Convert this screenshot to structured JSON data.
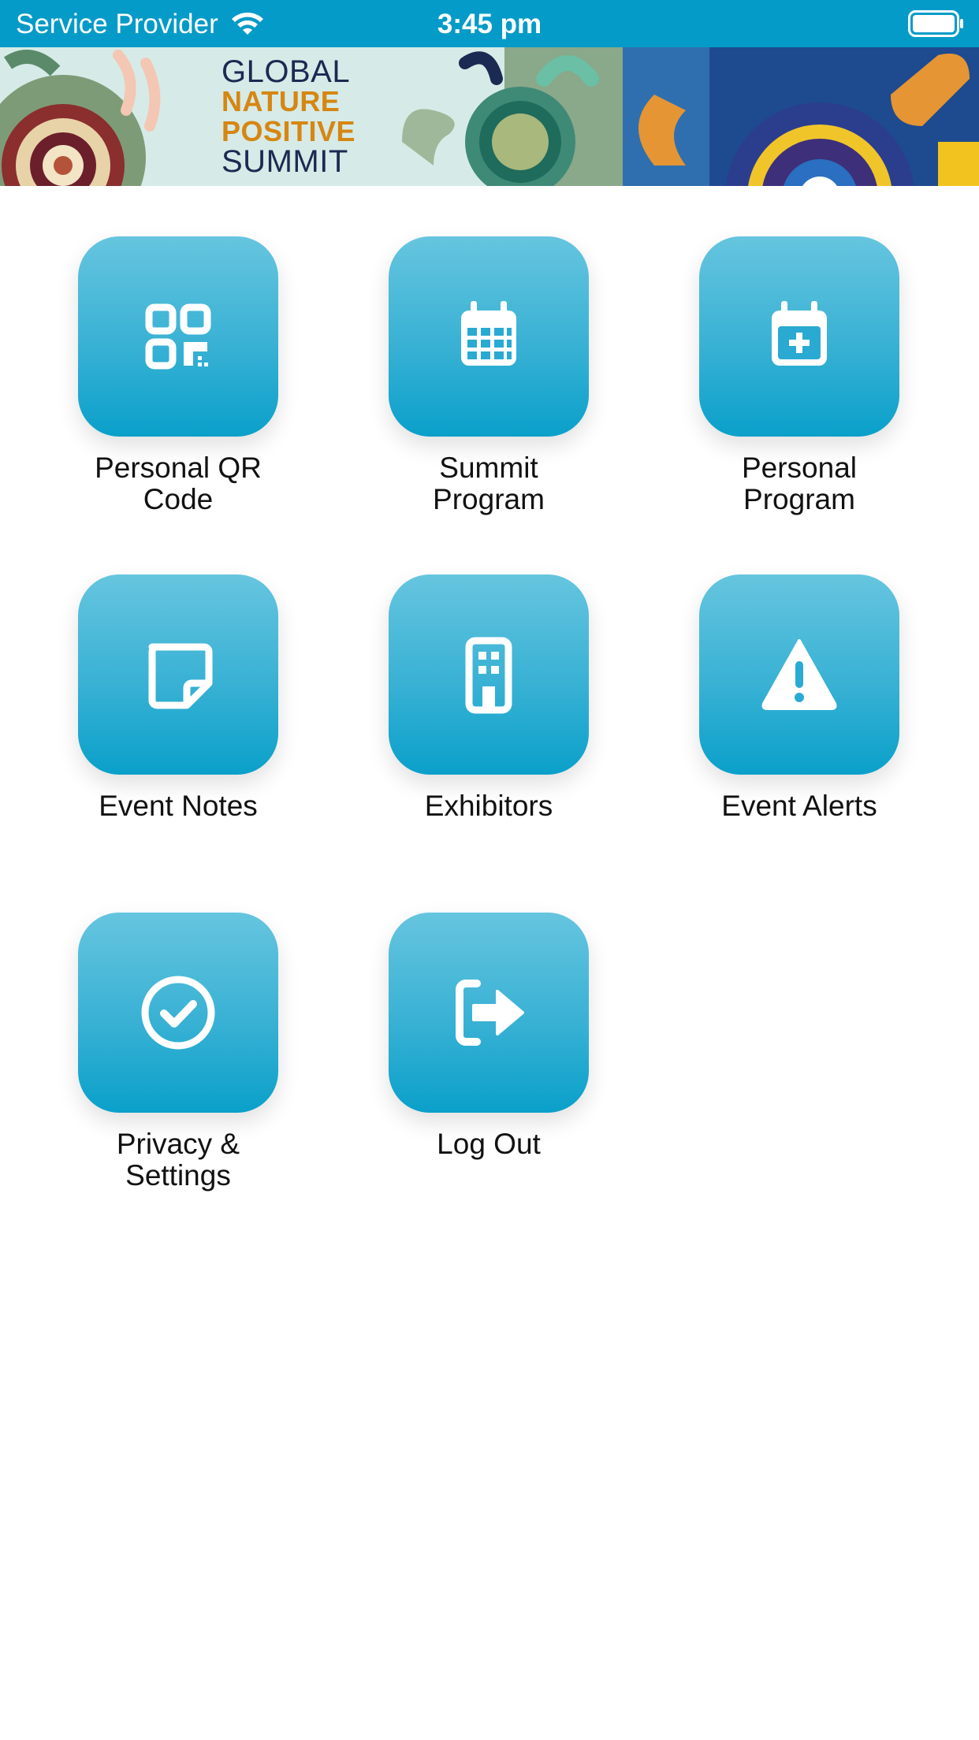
{
  "status_bar": {
    "carrier": "Service Provider",
    "time": "3:45 pm",
    "signal_icon": "wifi-icon",
    "battery_icon": "battery-icon"
  },
  "banner": {
    "line1": "GLOBAL",
    "line2": "NATURE",
    "line3": "POSITIVE",
    "line4": "SUMMIT"
  },
  "menu": {
    "items": [
      {
        "label": "Personal QR\nCode",
        "icon": "qr-code-icon"
      },
      {
        "label": "Summit\nProgram",
        "icon": "calendar-icon"
      },
      {
        "label": "Personal\nProgram",
        "icon": "calendar-plus-icon"
      },
      {
        "label": "Event Notes",
        "icon": "sticky-note-icon"
      },
      {
        "label": "Exhibitors",
        "icon": "building-icon"
      },
      {
        "label": "Event Alerts",
        "icon": "warning-icon"
      },
      {
        "label": "Privacy &\nSettings",
        "icon": "check-circle-icon"
      },
      {
        "label": "Log Out",
        "icon": "logout-icon"
      }
    ]
  },
  "colors": {
    "accent": "#049bc8",
    "tile_top": "#66c5df",
    "tile_bottom": "#0aa0ca",
    "banner_orange": "#d68612",
    "banner_navy": "#1b2a52"
  }
}
